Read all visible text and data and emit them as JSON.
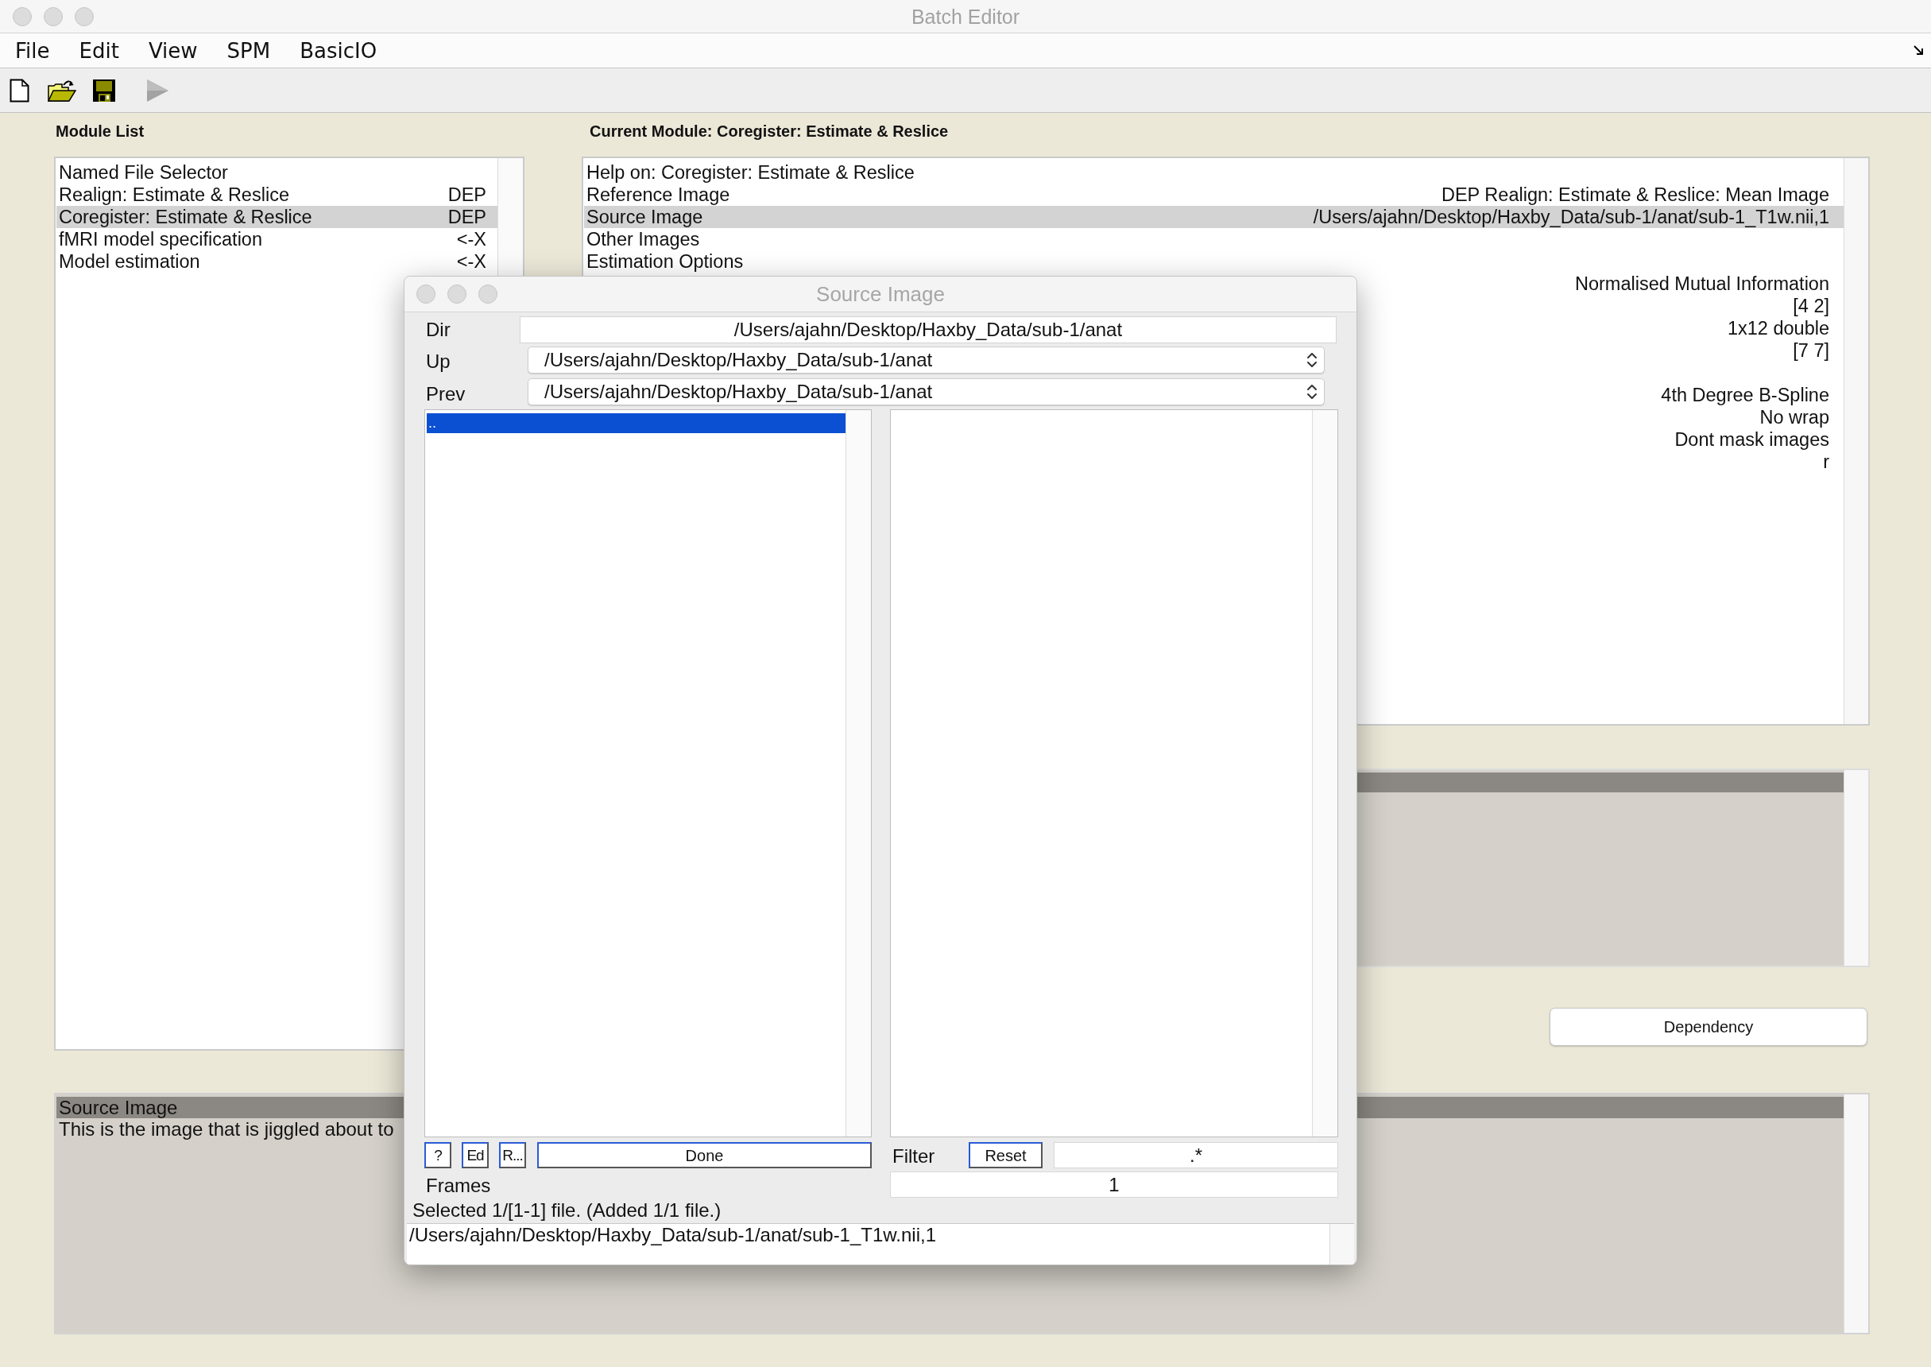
{
  "window": {
    "title": "Batch Editor"
  },
  "menu_bar": {
    "items": [
      "File",
      "Edit",
      "View",
      "SPM",
      "BasicIO"
    ]
  },
  "toolbar": {
    "buttons": [
      {
        "kind": "new",
        "disabled": false
      },
      {
        "kind": "open",
        "disabled": false
      },
      {
        "kind": "save",
        "disabled": false
      },
      {
        "kind": "run",
        "disabled": true
      }
    ]
  },
  "module_list": {
    "title": "Module List",
    "items": [
      {
        "label": "Named File Selector",
        "selected": false
      },
      {
        "label": "Realign: Estimate & Reslice",
        "status": "DEP",
        "selected": false
      },
      {
        "label": "Coregister: Estimate & Reslice",
        "status": "DEP",
        "selected": true
      },
      {
        "label": "fMRI model specification",
        "status": "<-X",
        "selected": false
      },
      {
        "label": "Model estimation",
        "status": "<-X",
        "selected": false
      }
    ]
  },
  "current_module": {
    "title": "Current Module: Coregister: Estimate & Reslice",
    "rows": [
      {
        "label": "Help on: Coregister: Estimate & Reslice",
        "selected": false
      },
      {
        "label": "Reference Image",
        "value": "DEP Realign: Estimate & Reslice: Mean Image",
        "selected": false
      },
      {
        "label": "Source Image",
        "value": "/Users/ajahn/Desktop/Haxby_Data/sub-1/anat/sub-1_T1w.nii,1",
        "selected": true
      },
      {
        "label": "Other Images",
        "selected": false
      },
      {
        "label": "Estimation Options",
        "selected": false
      },
      {
        "value": "Normalised Mutual Information",
        "selected": false
      },
      {
        "value": "[4 2]",
        "selected": false
      },
      {
        "value": "1x12 double",
        "selected": false
      },
      {
        "value": "[7 7]",
        "selected": false
      },
      {
        "selected": false
      },
      {
        "value": "4th Degree B-Spline",
        "selected": false
      },
      {
        "value": "No wrap",
        "selected": false
      },
      {
        "value": "Dont mask images",
        "selected": false
      },
      {
        "value": "r",
        "selected": false
      }
    ]
  },
  "dependency_button": {
    "label": "Dependency"
  },
  "help_panel": {
    "title": "Source Image",
    "text": "This is the image that is jiggled about to"
  },
  "file_dialog": {
    "title": "Source Image",
    "dir": {
      "label": "Dir",
      "value": "/Users/ajahn/Desktop/Haxby_Data/sub-1/anat"
    },
    "up": {
      "label": "Up",
      "value": "/Users/ajahn/Desktop/Haxby_Data/sub-1/anat"
    },
    "prev": {
      "label": "Prev",
      "value": "/Users/ajahn/Desktop/Haxby_Data/sub-1/anat"
    },
    "directory_list": {
      "items": [
        {
          "label": "..",
          "selected": true
        }
      ]
    },
    "buttons": [
      {
        "kind": "small",
        "label": "?"
      },
      {
        "kind": "small",
        "label": "Ed"
      },
      {
        "kind": "small",
        "label": "R..."
      },
      {
        "kind": "wide",
        "label": "Done"
      }
    ],
    "filter": {
      "label": "Filter",
      "button": "Reset",
      "value": ".*"
    },
    "frames": {
      "label": "Frames",
      "value": "1"
    },
    "status": "Selected 1/[1-1] file. (Added 1/1 file.)",
    "selected_files": [
      "/Users/ajahn/Desktop/Haxby_Data/sub-1/anat/sub-1_T1w.nii,1"
    ]
  }
}
